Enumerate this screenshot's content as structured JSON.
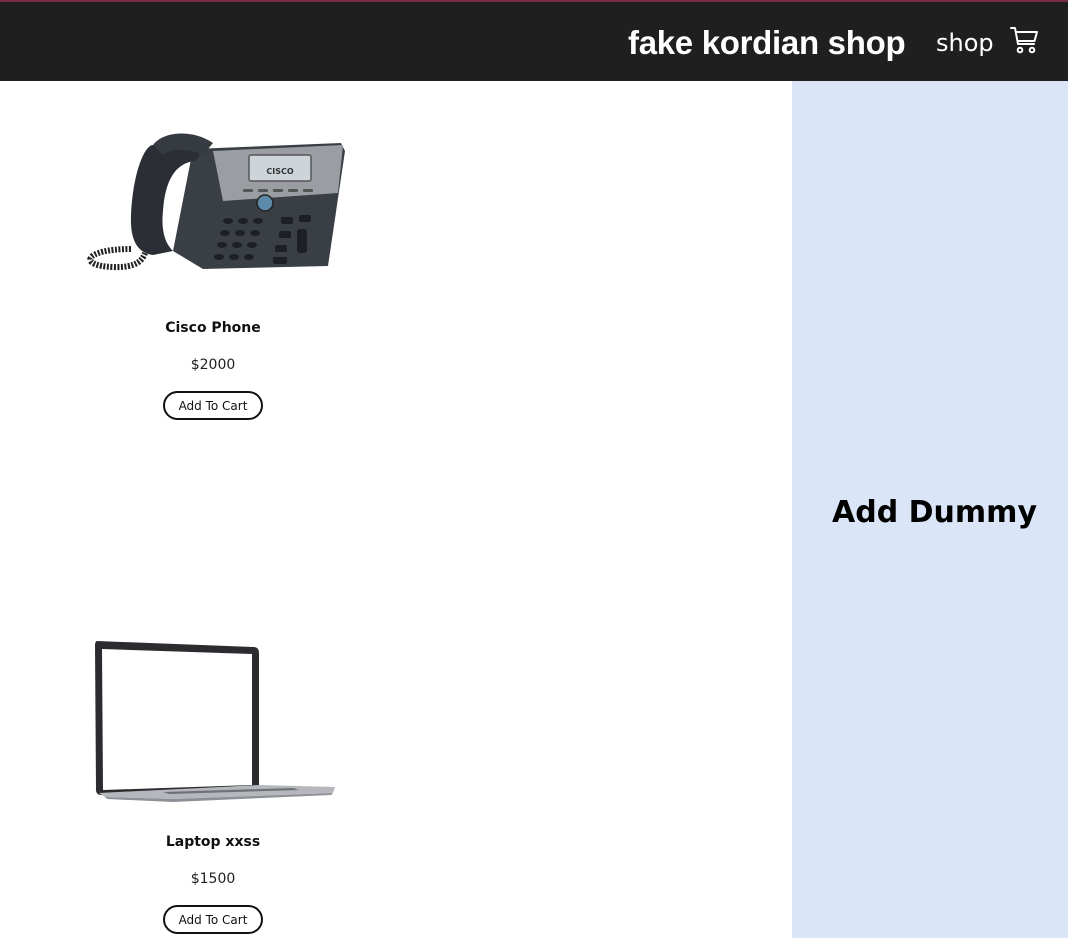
{
  "header": {
    "brand": "fake kordian shop",
    "shop_link": "shop",
    "cart_icon": "shopping-cart-icon"
  },
  "products": [
    {
      "name": "Cisco Phone",
      "price": "$2000",
      "button": "Add To Cart",
      "image": "desk-phone-image"
    },
    {
      "name": "Laptop xxss",
      "price": "$1500",
      "button": "Add To Cart",
      "image": "laptop-image"
    }
  ],
  "sidebar": {
    "action": "Add Dummy"
  },
  "colors": {
    "navbar": "#1f1f1f",
    "sidebar": "#dae6f8"
  }
}
